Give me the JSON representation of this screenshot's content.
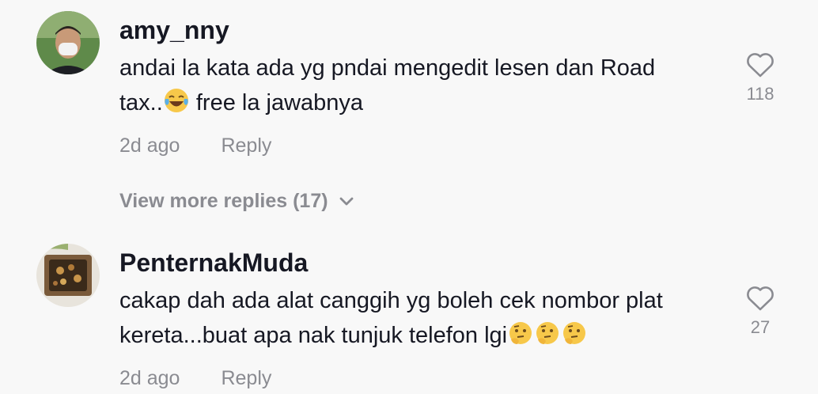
{
  "comments": [
    {
      "username": "amy_nny",
      "text_line1": "andai la kata ada yg pndai mengedit lesen dan Road",
      "text_line2_before": "tax..",
      "text_line2_emoji": "laughing-tears-emoji",
      "text_line2_after": " free la jawabnya",
      "time": "2d ago",
      "reply_label": "Reply",
      "like_count": "118"
    },
    {
      "username": "PenternakMuda",
      "text_line1": "cakap dah ada alat canggih yg boleh cek nombor plat",
      "text_line2_before": "kereta...buat apa nak tunjuk telefon lgi",
      "text_line2_emoji": "thinking-face-emoji",
      "time": "2d ago",
      "reply_label": "Reply",
      "like_count": "27"
    }
  ],
  "view_more": {
    "label": "View more replies (17)"
  },
  "colors": {
    "primary_text": "#161823",
    "secondary_text": "#8a8b91",
    "background": "#f8f8f8"
  }
}
